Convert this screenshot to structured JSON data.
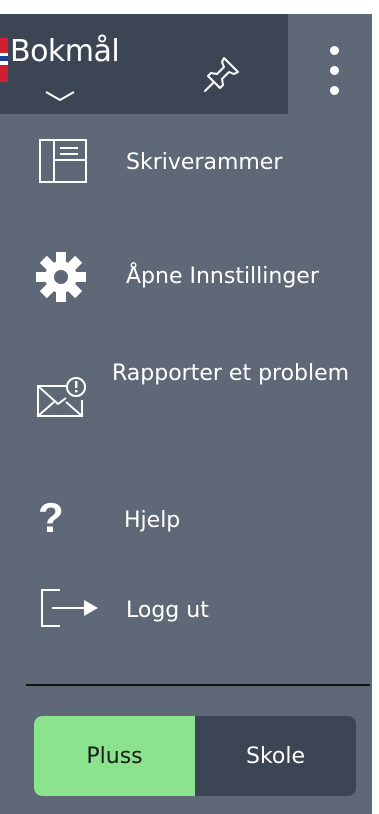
{
  "header": {
    "language_label": "Bokmål",
    "icons": {
      "flag": "norway-flag-icon",
      "chevron": "chevron-down-icon",
      "pin": "pin-icon",
      "more": "more-vertical-icon"
    }
  },
  "menu": {
    "items": [
      {
        "label": "Skriverammer",
        "icon": "writing-frame-icon"
      },
      {
        "label": "Åpne Innstillinger",
        "icon": "gear-icon"
      },
      {
        "label": "Rapporter et problem",
        "icon": "report-mail-icon"
      },
      {
        "label": "Hjelp",
        "icon": "question-icon"
      },
      {
        "label": "Logg ut",
        "icon": "logout-icon"
      }
    ]
  },
  "mode_toggle": {
    "options": [
      "Pluss",
      "Skole"
    ],
    "selected": "Pluss",
    "selected_color": "#8be38d"
  },
  "colors": {
    "panel": "#5e6876",
    "topbar": "#3b4554",
    "text": "#ffffff"
  }
}
